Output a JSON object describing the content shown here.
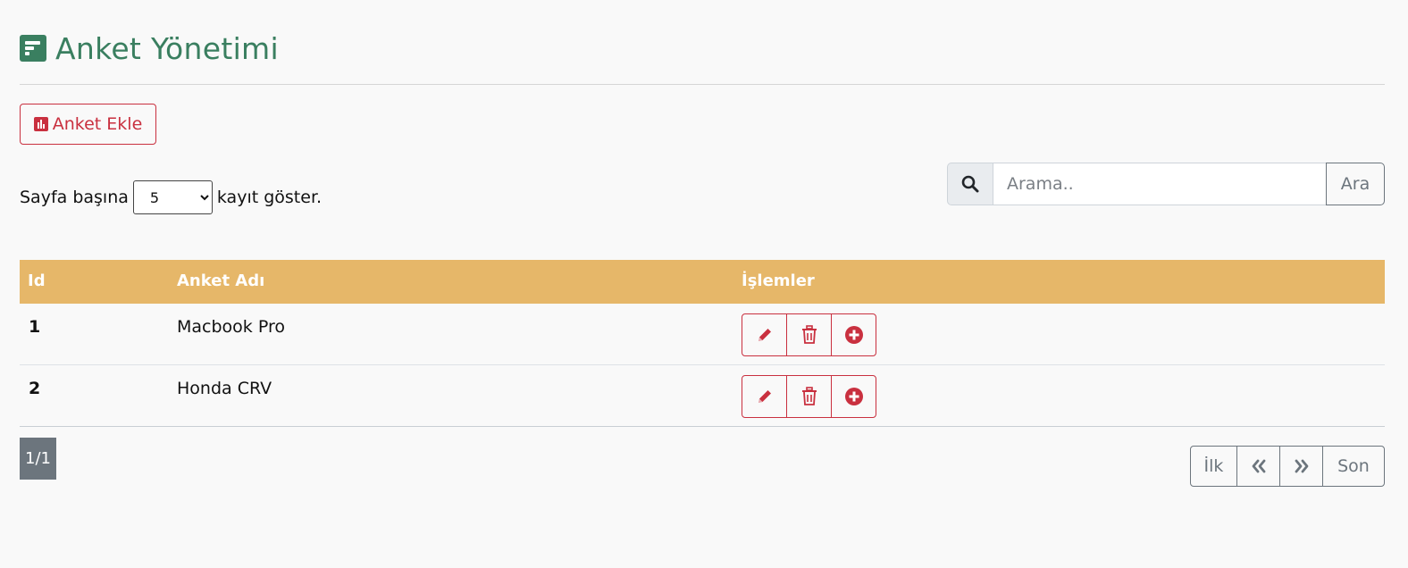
{
  "header": {
    "title": "Anket Yönetimi",
    "icon": "poll-h-icon",
    "color": "#3a7f60"
  },
  "toolbar": {
    "add_label": "Anket Ekle",
    "add_icon": "chart-bar-icon",
    "accent": "#c9303f"
  },
  "page_size": {
    "prefix": "Sayfa başına",
    "selected": "5",
    "suffix": "kayıt göster."
  },
  "search": {
    "placeholder": "Arama..",
    "button_label": "Ara",
    "icon": "search-icon"
  },
  "table": {
    "header_color": "#e6b769",
    "columns": [
      "Id",
      "Anket Adı",
      "İşlemler"
    ],
    "rows": [
      {
        "id": "1",
        "name": "Macbook Pro"
      },
      {
        "id": "2",
        "name": "Honda CRV"
      }
    ],
    "row_actions": [
      "edit-icon",
      "trash-icon",
      "plus-circle-icon"
    ]
  },
  "page_indicator": "1/1",
  "pagination": {
    "first": "İlk",
    "prev_icon": "angle-double-left-icon",
    "next_icon": "angle-double-right-icon",
    "last": "Son"
  }
}
